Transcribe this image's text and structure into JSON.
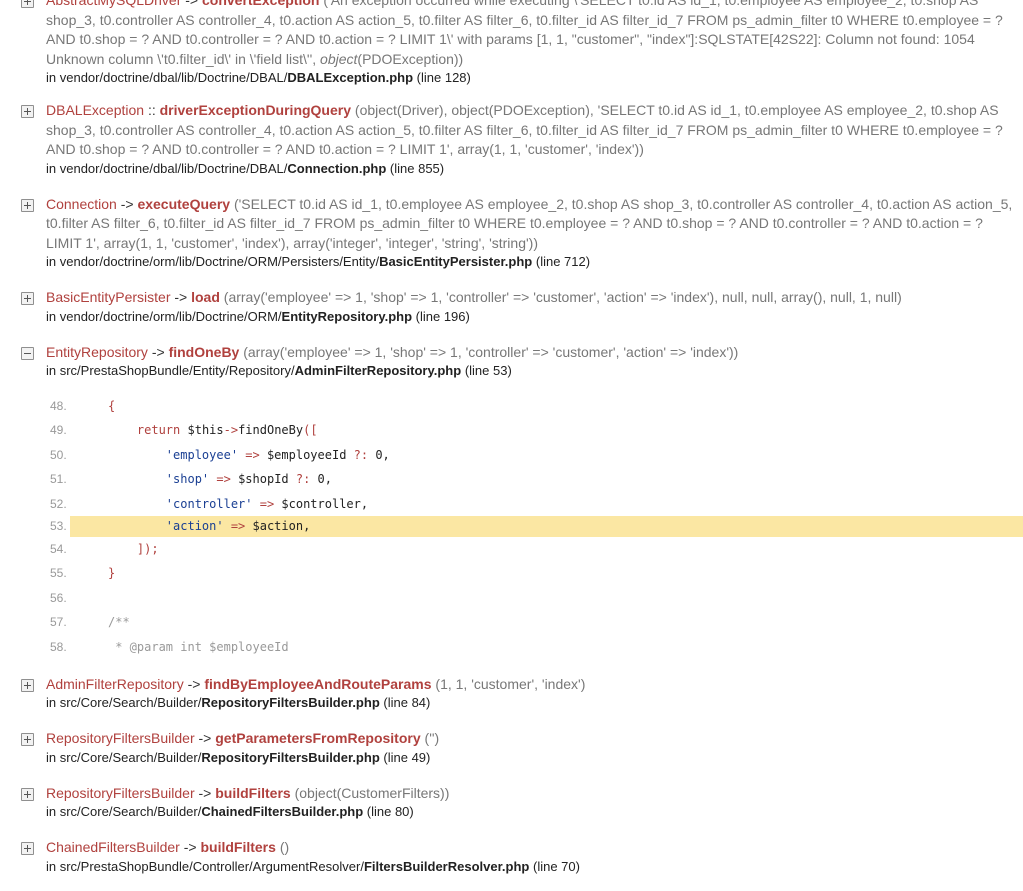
{
  "frames": [
    {
      "class": "AbstractMySQLDriver",
      "sep": "->",
      "method": "convertException",
      "args": "('An exception occurred while executing \\'SELECT t0.id AS id_1, t0.employee AS employee_2, t0.shop AS shop_3, t0.controller AS controller_4, t0.action AS action_5, t0.filter AS filter_6, t0.filter_id AS filter_id_7 FROM ps_admin_filter t0 WHERE t0.employee = ? AND t0.shop = ? AND t0.controller = ? AND t0.action = ? LIMIT 1\\' with params [1, 1, \"customer\", \"index\"]:SQLSTATE[42S22]: Column not found: 1054 Unknown column \\'t0.filter_id\\' in \\'field list\\'', ",
      "args_obj": "object",
      "args_tail": "(PDOException))",
      "path": "in vendor/doctrine/dbal/lib/Doctrine/DBAL/",
      "file": "DBALException.php",
      "line": "(line 128)"
    },
    {
      "class": "DBALException",
      "sep": "::",
      "method": "driverExceptionDuringQuery",
      "args": "(object(Driver), object(PDOException), 'SELECT t0.id AS id_1, t0.employee AS employee_2, t0.shop AS shop_3, t0.controller AS controller_4, t0.action AS action_5, t0.filter AS filter_6, t0.filter_id AS filter_id_7 FROM ps_admin_filter t0 WHERE t0.employee = ? AND t0.shop = ? AND t0.controller = ? AND t0.action = ? LIMIT 1', array(1, 1, 'customer', 'index'))",
      "path": "in vendor/doctrine/dbal/lib/Doctrine/DBAL/",
      "file": "Connection.php",
      "line": "(line 855)"
    },
    {
      "class": "Connection",
      "sep": "->",
      "method": "executeQuery",
      "args": "('SELECT t0.id AS id_1, t0.employee AS employee_2, t0.shop AS shop_3, t0.controller AS controller_4, t0.action AS action_5, t0.filter AS filter_6, t0.filter_id AS filter_id_7 FROM ps_admin_filter t0 WHERE t0.employee = ? AND t0.shop = ? AND t0.controller = ? AND t0.action = ? LIMIT 1', array(1, 1, 'customer', 'index'), array('integer', 'integer', 'string', 'string'))",
      "path": "in vendor/doctrine/orm/lib/Doctrine/ORM/Persisters/Entity/",
      "file": "BasicEntityPersister.php",
      "line": "(line 712)"
    },
    {
      "class": "BasicEntityPersister",
      "sep": "->",
      "method": "load",
      "args": "(array('employee' => 1, 'shop' => 1, 'controller' => 'customer', 'action' => 'index'), null, null, array(), null, 1, null)",
      "path": "in vendor/doctrine/orm/lib/Doctrine/ORM/",
      "file": "EntityRepository.php",
      "line": "(line 196)"
    },
    {
      "class": "EntityRepository",
      "sep": "->",
      "method": "findOneBy",
      "args": "(array('employee' => 1, 'shop' => 1, 'controller' => 'customer', 'action' => 'index'))",
      "path": "in src/PrestaShopBundle/Entity/Repository/",
      "file": "AdminFilterRepository.php",
      "line": "(line 53)",
      "expanded": true
    },
    {
      "class": "AdminFilterRepository",
      "sep": "->",
      "method": "findByEmployeeAndRouteParams",
      "args": "(1, 1, 'customer', 'index')",
      "path": "in src/Core/Search/Builder/",
      "file": "RepositoryFiltersBuilder.php",
      "line": "(line 84)"
    },
    {
      "class": "RepositoryFiltersBuilder",
      "sep": "->",
      "method": "getParametersFromRepository",
      "args": "('')",
      "path": "in src/Core/Search/Builder/",
      "file": "RepositoryFiltersBuilder.php",
      "line": "(line 49)"
    },
    {
      "class": "RepositoryFiltersBuilder",
      "sep": "->",
      "method": "buildFilters",
      "args": "(object(CustomerFilters))",
      "path": "in src/Core/Search/Builder/",
      "file": "ChainedFiltersBuilder.php",
      "line": "(line 80)"
    },
    {
      "class": "ChainedFiltersBuilder",
      "sep": "->",
      "method": "buildFilters",
      "args": "()",
      "path": "in src/PrestaShopBundle/Controller/ArgumentResolver/",
      "file": "FiltersBuilderResolver.php",
      "line": "(line 70)"
    }
  ],
  "code": [
    {
      "num": "48.",
      "text": "    {"
    },
    {
      "num": "49.",
      "text": "        return $this->findOneBy(["
    },
    {
      "num": "50.",
      "text": "            'employee' => $employeeId ?: 0,"
    },
    {
      "num": "51.",
      "text": "            'shop' => $shopId ?: 0,"
    },
    {
      "num": "52.",
      "text": "            'controller' => $controller,"
    },
    {
      "num": "53.",
      "text": "            'action' => $action,",
      "highlight": true
    },
    {
      "num": "54.",
      "text": "        ]);"
    },
    {
      "num": "55.",
      "text": "    }"
    },
    {
      "num": "56.",
      "text": ""
    },
    {
      "num": "57.",
      "text": "    /**"
    },
    {
      "num": "58.",
      "text": "     * @param int $employeeId"
    }
  ]
}
